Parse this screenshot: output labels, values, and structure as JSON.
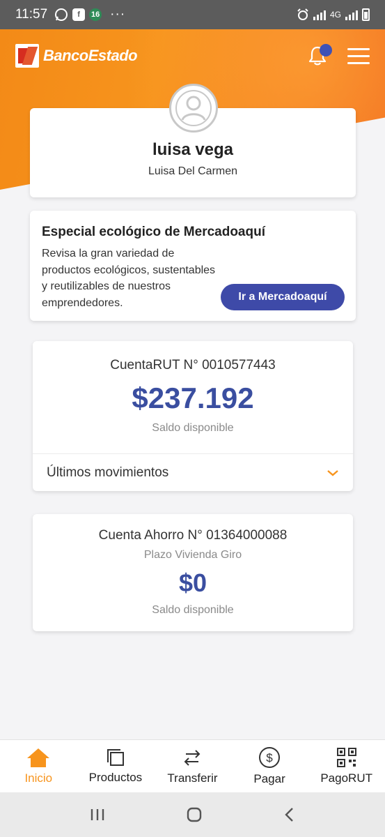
{
  "status_bar": {
    "time": "11:57",
    "calendar_badge": "16",
    "more": "···",
    "network": "4G"
  },
  "header": {
    "brand": "BancoEstado"
  },
  "profile": {
    "name": "luisa vega",
    "full_name": "Luisa Del Carmen"
  },
  "promo": {
    "title": "Especial ecológico de Mercadoaquí",
    "text": "Revisa la gran variedad de productos ecológicos, sustentables y reutilizables de nuestros emprendedores.",
    "button_label": "Ir a Mercadoaquí"
  },
  "accounts": [
    {
      "title": "CuentaRUT N° 0010577443",
      "balance": "$237.192",
      "caption": "Saldo disponible",
      "movements_label": "Últimos movimientos"
    },
    {
      "title": "Cuenta Ahorro N° 01364000088",
      "subtitle": "Plazo Vivienda Giro",
      "balance": "$0",
      "caption": "Saldo disponible"
    }
  ],
  "bottom_nav": [
    {
      "label": "Inicio",
      "icon": "home-icon",
      "active": true
    },
    {
      "label": "Productos",
      "icon": "products-icon"
    },
    {
      "label": "Transferir",
      "icon": "transfer-icon"
    },
    {
      "label": "Pagar",
      "icon": "pay-icon"
    },
    {
      "label": "PagoRUT",
      "icon": "qr-icon"
    }
  ],
  "colors": {
    "brand_orange": "#f7941d",
    "accent_blue": "#3e4aa8",
    "balance_blue": "#3a4ea0"
  }
}
